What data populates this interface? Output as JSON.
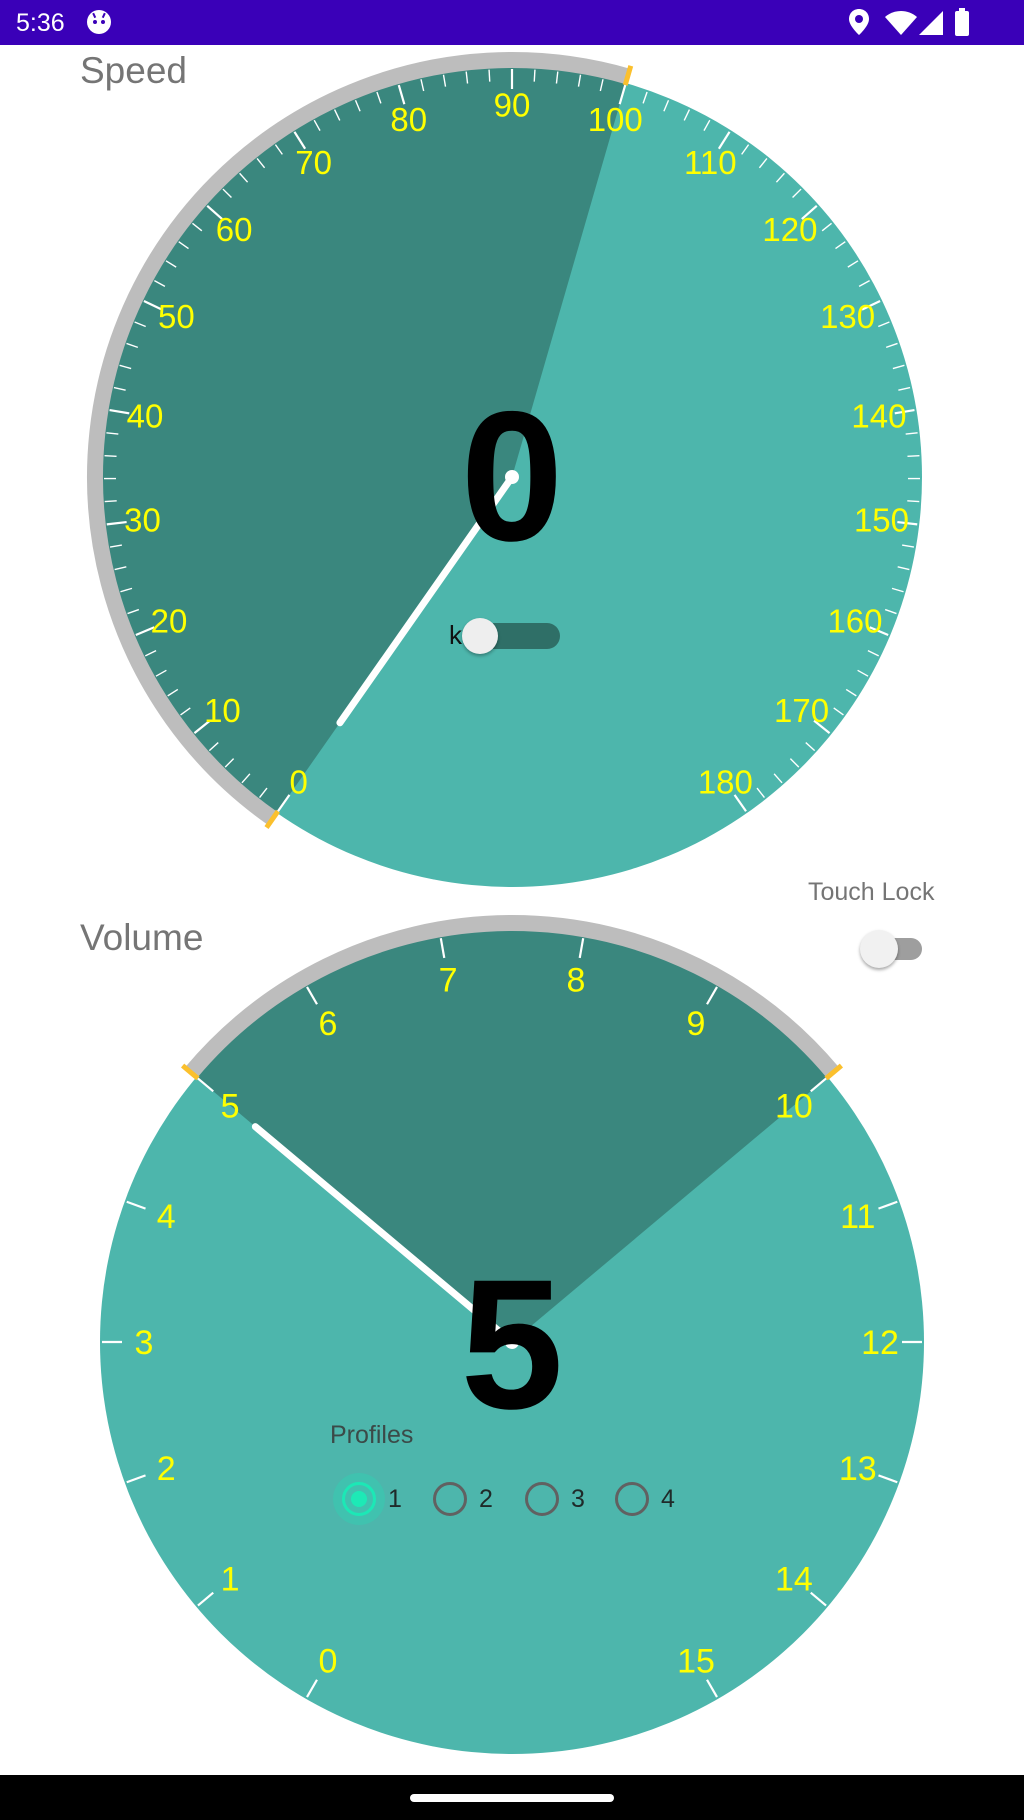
{
  "status_bar": {
    "time": "5:36",
    "icons": [
      "android-debug-icon",
      "location-icon",
      "wifi-icon",
      "signal-icon",
      "battery-icon"
    ],
    "background": "#3a00b8"
  },
  "speed_gauge": {
    "title": "Speed",
    "value": "0",
    "unit": "km/h",
    "tick_labels": [
      "0",
      "10",
      "20",
      "30",
      "40",
      "50",
      "60",
      "70",
      "80",
      "90",
      "100",
      "110",
      "120",
      "130",
      "140",
      "150",
      "160",
      "170",
      "180"
    ],
    "min": 0,
    "max": 180,
    "needle_value": 0,
    "highlight_range": [
      0,
      100
    ],
    "colors": {
      "face": "#4db6ac",
      "highlight": "#3a877e",
      "rim": "#bdbdbd",
      "tick_label": "#ffff00",
      "limit_marker": "#fbc02d"
    }
  },
  "volume_gauge": {
    "title": "Volume",
    "value": "5",
    "tick_labels": [
      "0",
      "1",
      "2",
      "3",
      "4",
      "5",
      "6",
      "7",
      "8",
      "9",
      "10",
      "11",
      "12",
      "13",
      "14",
      "15"
    ],
    "min": 0,
    "max": 15,
    "needle_value": 5,
    "highlight_range": [
      5,
      10
    ],
    "colors": {
      "face": "#4db6ac",
      "highlight": "#3a877e",
      "rim": "#bdbdbd",
      "tick_label": "#ffff00",
      "limit_marker": "#fbc02d"
    }
  },
  "touch_lock": {
    "label": "Touch Lock",
    "checked": false
  },
  "profiles": {
    "label": "Profiles",
    "options": [
      "1",
      "2",
      "3",
      "4"
    ],
    "selected": "1",
    "accent": "#1de9b6"
  }
}
